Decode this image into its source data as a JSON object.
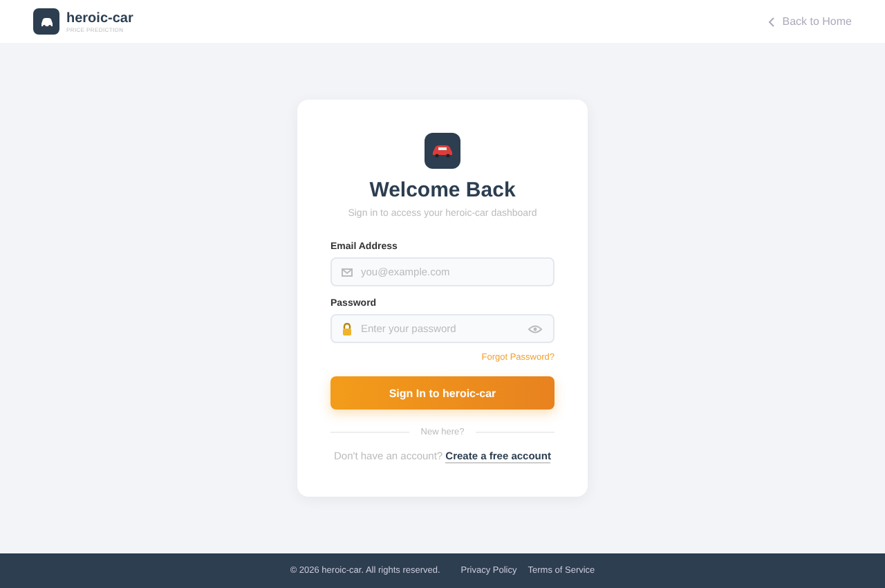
{
  "header": {
    "brand": "heroic-car",
    "tagline": "PRICE PREDICTION",
    "back_link": "Back to Home"
  },
  "card": {
    "title": "Welcome Back",
    "subtitle": "Sign in to access your heroic-car dashboard",
    "fields": [
      {
        "kind": "email",
        "label": "Email Address",
        "placeholder": "you@example.com"
      },
      {
        "kind": "password",
        "label": "Password",
        "placeholder": "Enter your password"
      }
    ],
    "forgot_link": "Forgot Password?",
    "submit": "Sign In to heroic-car",
    "divider": "New here?",
    "signup_prompt": "Don't have an account?",
    "signup_link": "Create a free account"
  },
  "footer": {
    "copyright": "© 2026 heroic-car. All rights reserved.",
    "links": [
      "Privacy Policy",
      "Terms of Service"
    ]
  }
}
